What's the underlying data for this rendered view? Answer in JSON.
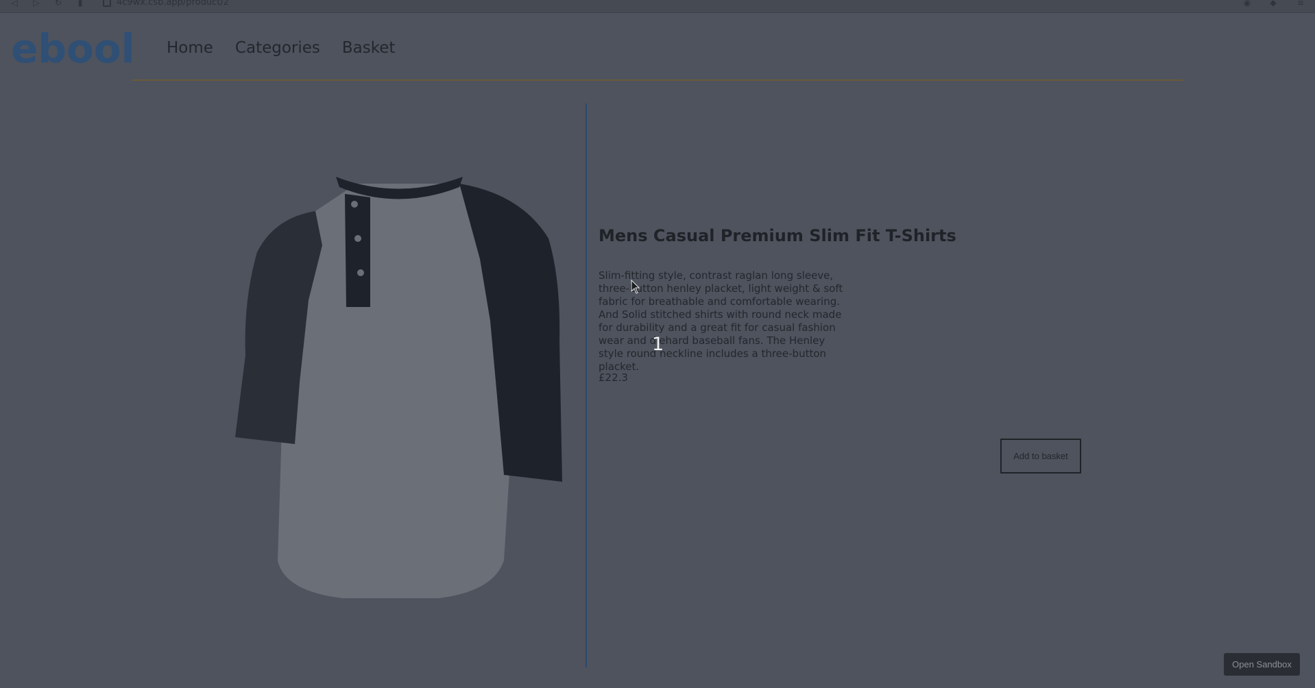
{
  "browser": {
    "url": "4c9wx.csb.app/product/2"
  },
  "header": {
    "logo": "ebool",
    "nav": [
      "Home",
      "Categories",
      "Basket"
    ]
  },
  "product": {
    "title": "Mens Casual Premium Slim Fit T-Shirts",
    "description": "Slim-fitting style, contrast raglan long sleeve, three-button henley placket, light weight & soft fabric for breathable and comfortable wearing. And Solid stitched shirts with round neck made for durability and a great fit for casual fashion wear and diehard baseball fans. The Henley style round neckline includes a three-button placket.",
    "price": "£22.3",
    "add_button": "Add to basket"
  },
  "overlay": {
    "step_number": "1",
    "sandbox_button": "Open Sandbox"
  },
  "colors": {
    "page_bg": "#4e535d",
    "logo": "#2f4f75",
    "divider": "#2b4a6d",
    "header_rule": "#6a5a3a"
  }
}
